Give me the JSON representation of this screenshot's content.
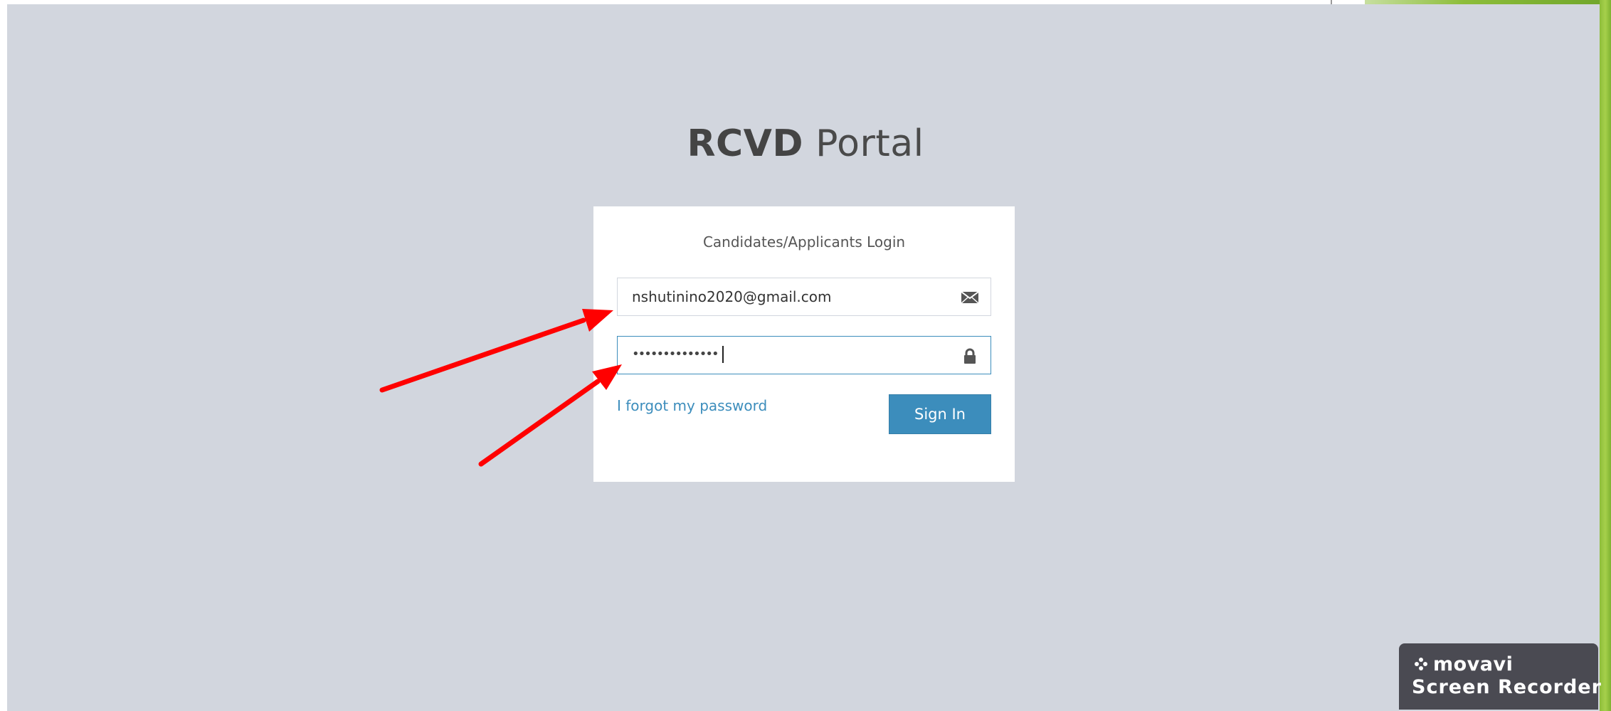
{
  "portal": {
    "title_bold": "RCVD",
    "title_light": " Portal"
  },
  "login": {
    "subtitle": "Candidates/Applicants Login",
    "email_value": "nshutinino2020@gmail.com",
    "password_masked": "••••••••••••••",
    "forgot_label": "I forgot my password",
    "signin_label": "Sign In"
  },
  "icons": {
    "email": "envelope-icon",
    "password": "lock-icon"
  },
  "watermark": {
    "brand": "movavi",
    "product": "Screen Recorder"
  },
  "colors": {
    "background": "#d2d6de",
    "accent": "#3c8dbc",
    "arrow": "#ff0000",
    "watermark_bg": "#4a4a52"
  }
}
